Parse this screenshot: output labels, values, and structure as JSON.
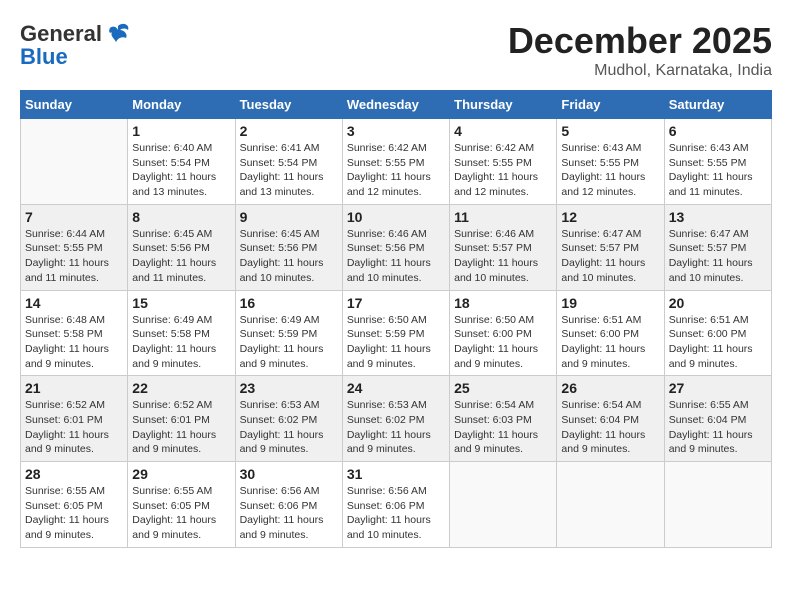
{
  "header": {
    "logo_general": "General",
    "logo_blue": "Blue",
    "month": "December 2025",
    "location": "Mudhol, Karnataka, India"
  },
  "days_of_week": [
    "Sunday",
    "Monday",
    "Tuesday",
    "Wednesday",
    "Thursday",
    "Friday",
    "Saturday"
  ],
  "weeks": [
    [
      {
        "day": "",
        "info": ""
      },
      {
        "day": "1",
        "info": "Sunrise: 6:40 AM\nSunset: 5:54 PM\nDaylight: 11 hours\nand 13 minutes."
      },
      {
        "day": "2",
        "info": "Sunrise: 6:41 AM\nSunset: 5:54 PM\nDaylight: 11 hours\nand 13 minutes."
      },
      {
        "day": "3",
        "info": "Sunrise: 6:42 AM\nSunset: 5:55 PM\nDaylight: 11 hours\nand 12 minutes."
      },
      {
        "day": "4",
        "info": "Sunrise: 6:42 AM\nSunset: 5:55 PM\nDaylight: 11 hours\nand 12 minutes."
      },
      {
        "day": "5",
        "info": "Sunrise: 6:43 AM\nSunset: 5:55 PM\nDaylight: 11 hours\nand 12 minutes."
      },
      {
        "day": "6",
        "info": "Sunrise: 6:43 AM\nSunset: 5:55 PM\nDaylight: 11 hours\nand 11 minutes."
      }
    ],
    [
      {
        "day": "7",
        "info": "Sunrise: 6:44 AM\nSunset: 5:55 PM\nDaylight: 11 hours\nand 11 minutes."
      },
      {
        "day": "8",
        "info": "Sunrise: 6:45 AM\nSunset: 5:56 PM\nDaylight: 11 hours\nand 11 minutes."
      },
      {
        "day": "9",
        "info": "Sunrise: 6:45 AM\nSunset: 5:56 PM\nDaylight: 11 hours\nand 10 minutes."
      },
      {
        "day": "10",
        "info": "Sunrise: 6:46 AM\nSunset: 5:56 PM\nDaylight: 11 hours\nand 10 minutes."
      },
      {
        "day": "11",
        "info": "Sunrise: 6:46 AM\nSunset: 5:57 PM\nDaylight: 11 hours\nand 10 minutes."
      },
      {
        "day": "12",
        "info": "Sunrise: 6:47 AM\nSunset: 5:57 PM\nDaylight: 11 hours\nand 10 minutes."
      },
      {
        "day": "13",
        "info": "Sunrise: 6:47 AM\nSunset: 5:57 PM\nDaylight: 11 hours\nand 10 minutes."
      }
    ],
    [
      {
        "day": "14",
        "info": "Sunrise: 6:48 AM\nSunset: 5:58 PM\nDaylight: 11 hours\nand 9 minutes."
      },
      {
        "day": "15",
        "info": "Sunrise: 6:49 AM\nSunset: 5:58 PM\nDaylight: 11 hours\nand 9 minutes."
      },
      {
        "day": "16",
        "info": "Sunrise: 6:49 AM\nSunset: 5:59 PM\nDaylight: 11 hours\nand 9 minutes."
      },
      {
        "day": "17",
        "info": "Sunrise: 6:50 AM\nSunset: 5:59 PM\nDaylight: 11 hours\nand 9 minutes."
      },
      {
        "day": "18",
        "info": "Sunrise: 6:50 AM\nSunset: 6:00 PM\nDaylight: 11 hours\nand 9 minutes."
      },
      {
        "day": "19",
        "info": "Sunrise: 6:51 AM\nSunset: 6:00 PM\nDaylight: 11 hours\nand 9 minutes."
      },
      {
        "day": "20",
        "info": "Sunrise: 6:51 AM\nSunset: 6:00 PM\nDaylight: 11 hours\nand 9 minutes."
      }
    ],
    [
      {
        "day": "21",
        "info": "Sunrise: 6:52 AM\nSunset: 6:01 PM\nDaylight: 11 hours\nand 9 minutes."
      },
      {
        "day": "22",
        "info": "Sunrise: 6:52 AM\nSunset: 6:01 PM\nDaylight: 11 hours\nand 9 minutes."
      },
      {
        "day": "23",
        "info": "Sunrise: 6:53 AM\nSunset: 6:02 PM\nDaylight: 11 hours\nand 9 minutes."
      },
      {
        "day": "24",
        "info": "Sunrise: 6:53 AM\nSunset: 6:02 PM\nDaylight: 11 hours\nand 9 minutes."
      },
      {
        "day": "25",
        "info": "Sunrise: 6:54 AM\nSunset: 6:03 PM\nDaylight: 11 hours\nand 9 minutes."
      },
      {
        "day": "26",
        "info": "Sunrise: 6:54 AM\nSunset: 6:04 PM\nDaylight: 11 hours\nand 9 minutes."
      },
      {
        "day": "27",
        "info": "Sunrise: 6:55 AM\nSunset: 6:04 PM\nDaylight: 11 hours\nand 9 minutes."
      }
    ],
    [
      {
        "day": "28",
        "info": "Sunrise: 6:55 AM\nSunset: 6:05 PM\nDaylight: 11 hours\nand 9 minutes."
      },
      {
        "day": "29",
        "info": "Sunrise: 6:55 AM\nSunset: 6:05 PM\nDaylight: 11 hours\nand 9 minutes."
      },
      {
        "day": "30",
        "info": "Sunrise: 6:56 AM\nSunset: 6:06 PM\nDaylight: 11 hours\nand 9 minutes."
      },
      {
        "day": "31",
        "info": "Sunrise: 6:56 AM\nSunset: 6:06 PM\nDaylight: 11 hours\nand 10 minutes."
      },
      {
        "day": "",
        "info": ""
      },
      {
        "day": "",
        "info": ""
      },
      {
        "day": "",
        "info": ""
      }
    ]
  ]
}
